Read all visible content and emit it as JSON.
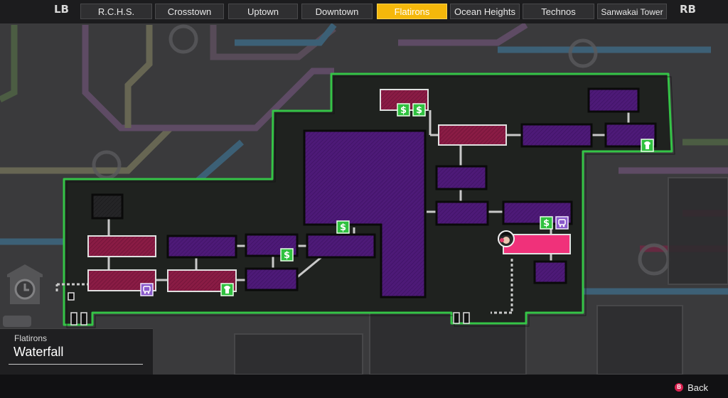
{
  "topbar": {
    "left_bumper": "LB",
    "right_bumper": "RB",
    "tabs": [
      {
        "label": "R.C.H.S."
      },
      {
        "label": "Crosstown"
      },
      {
        "label": "Uptown"
      },
      {
        "label": "Downtown"
      },
      {
        "label": "Flatirons",
        "active": true
      },
      {
        "label": "Ocean Heights"
      },
      {
        "label": "Technos"
      },
      {
        "label": "Sanwakai Tower"
      }
    ]
  },
  "location": {
    "district": "Flatirons",
    "area": "Waterfall"
  },
  "footer": {
    "back_button_key": "B",
    "back_label": "Back"
  },
  "colors": {
    "active_tab": "#f5b80b",
    "district_outline": "#35c447",
    "room_purple": "#4e1a78",
    "room_red": "#8a1c45",
    "current_room": "#f0317a",
    "shop_icon": "#2fc13f",
    "transit_icon": "#8a5acb"
  },
  "map_icons": {
    "shop": "dollar-icon",
    "clothing": "shirt-icon",
    "transit": "bus-icon",
    "player": "player-marker-icon",
    "save_point": "clock-icon"
  }
}
